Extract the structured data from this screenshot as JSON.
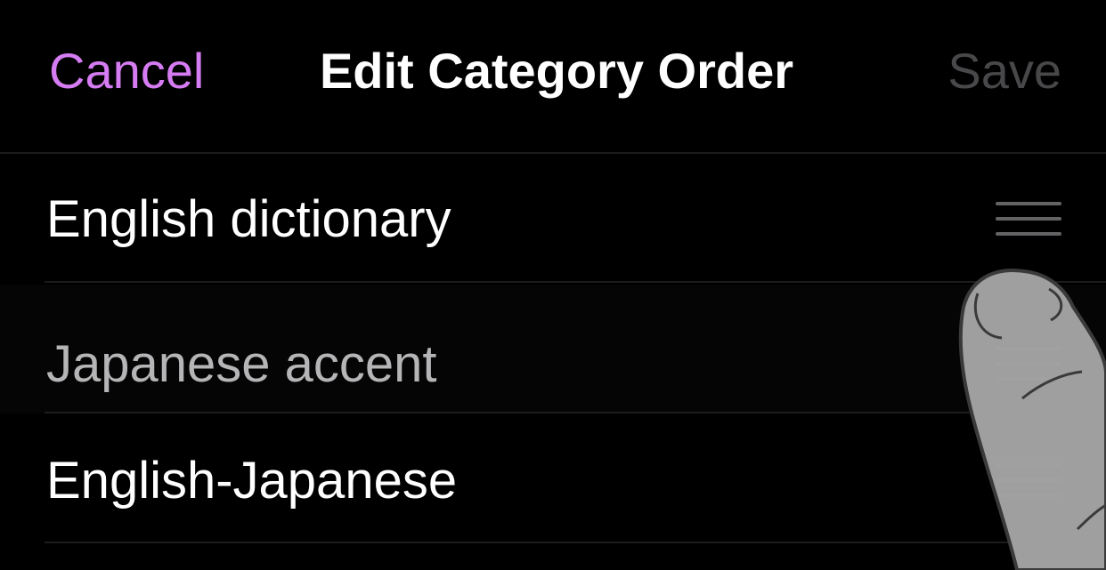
{
  "nav": {
    "cancel_label": "Cancel",
    "title": "Edit Category Order",
    "save_label": "Save"
  },
  "categories": [
    {
      "label": "English dictionary"
    },
    {
      "label": "Japanese accent"
    },
    {
      "label": "English-Japanese"
    }
  ],
  "colors": {
    "background": "#000000",
    "accent": "#d67cf2",
    "disabled": "#48484a",
    "text": "#ffffff",
    "handle": "#636366"
  },
  "icons": [
    "drag-handle-icon",
    "finger-pointer-icon"
  ]
}
